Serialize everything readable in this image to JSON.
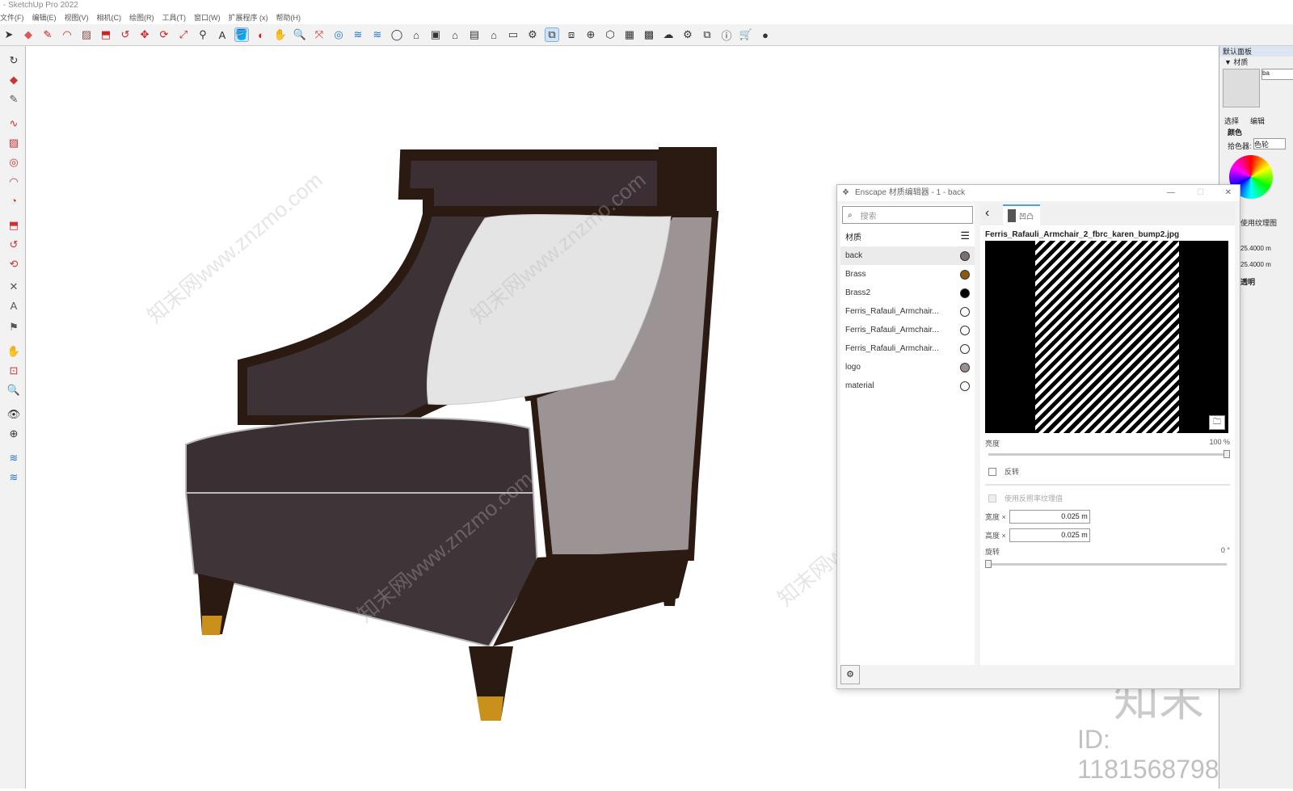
{
  "app": {
    "title": "- SketchUp Pro 2022"
  },
  "menu": [
    "文件(F)",
    "编辑(E)",
    "视图(V)",
    "相机(C)",
    "绘图(R)",
    "工具(T)",
    "窗口(W)",
    "扩展程序 (x)",
    "帮助(H)"
  ],
  "tray": {
    "title": "默认面板",
    "section": "▼ 材质",
    "tab_select": "选择",
    "tab_edit": "编辑",
    "color_label": "颜色",
    "picker_label": "拾色器:",
    "picker_value": "色轮",
    "texture_label": "使用纹理图",
    "width_value": "25.4000 m",
    "height_value": "25.4000 m",
    "opacity_label": "透明",
    "name_value": "ba"
  },
  "enscape": {
    "title": "Enscape 材质编辑器 - 1 - back",
    "search_placeholder": "搜索",
    "materials_header": "材质",
    "materials": [
      {
        "name": "back",
        "color": "#7a7070"
      },
      {
        "name": "Brass",
        "color": "#8a5a10"
      },
      {
        "name": "Brass2",
        "color": "#000000"
      },
      {
        "name": "Ferris_Rafauli_Armchair...",
        "color": "#ffffff"
      },
      {
        "name": "Ferris_Rafauli_Armchair...",
        "color": "#ffffff"
      },
      {
        "name": "Ferris_Rafauli_Armchair...",
        "color": "#ffffff"
      },
      {
        "name": "logo",
        "color": "#9a9090"
      },
      {
        "name": "material",
        "color": "#ffffff"
      }
    ],
    "tab_label": "凹凸",
    "texture_name": "Ferris_Rafauli_Armchair_2_fbrc_karen_bump2.jpg",
    "brightness_label": "亮度",
    "brightness_value": "100 %",
    "brightness": 100,
    "invert_label": "反转",
    "use_reflect_label": "使用反照率纹理值",
    "width_label": "宽度 ×",
    "width_value": "0.025 m",
    "height_label": "高度 ×",
    "height_value": "0.025 m",
    "rotation_label": "旋转",
    "rotation_value": "0 °",
    "rotation": 0
  },
  "watermark": {
    "logo": "知末",
    "id": "ID: 1181568798",
    "site": "知末网www.znzmo.com"
  }
}
